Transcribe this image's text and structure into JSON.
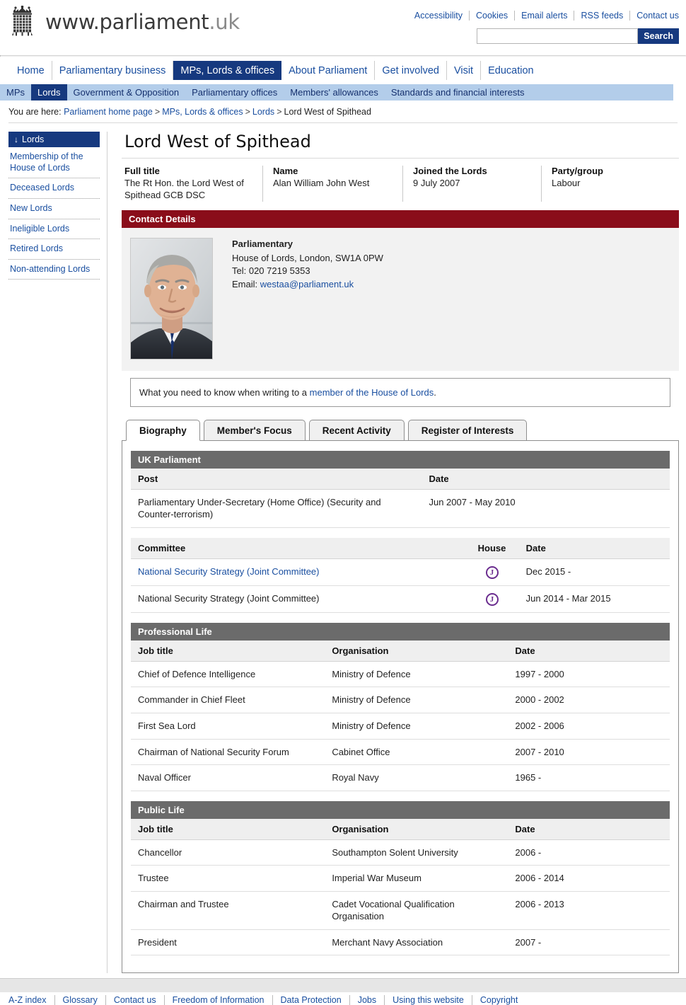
{
  "header": {
    "brand_main": "www.parliament",
    "brand_suffix": ".uk",
    "logo_icon": "portcullis-crown-icon",
    "util_links": [
      "Accessibility",
      "Cookies",
      "Email alerts",
      "RSS feeds",
      "Contact us"
    ],
    "search": {
      "value": "",
      "placeholder": "",
      "button_label": "Search"
    }
  },
  "nav_primary": {
    "items": [
      {
        "label": "Home",
        "active": false
      },
      {
        "label": "Parliamentary business",
        "active": false
      },
      {
        "label": "MPs, Lords & offices",
        "active": true
      },
      {
        "label": "About Parliament",
        "active": false
      },
      {
        "label": "Get involved",
        "active": false
      },
      {
        "label": "Visit",
        "active": false
      },
      {
        "label": "Education",
        "active": false
      }
    ]
  },
  "nav_secondary": {
    "items": [
      {
        "label": "MPs",
        "active": false
      },
      {
        "label": "Lords",
        "active": true
      },
      {
        "label": "Government & Opposition",
        "active": false
      },
      {
        "label": "Parliamentary offices",
        "active": false
      },
      {
        "label": "Members' allowances",
        "active": false
      },
      {
        "label": "Standards and financial interests",
        "active": false
      }
    ]
  },
  "breadcrumb": {
    "prefix": "You are here:",
    "items": [
      "Parliament home page",
      "MPs, Lords & offices",
      "Lords",
      "Lord West of Spithead"
    ],
    "separator": ">"
  },
  "sidebar": {
    "heading": "Lords",
    "heading_icon": "down-arrow-icon",
    "items": [
      {
        "label": "Membership of the House of Lords"
      },
      {
        "label": "Deceased Lords"
      },
      {
        "label": "New Lords"
      },
      {
        "label": "Ineligible Lords"
      },
      {
        "label": "Retired Lords"
      },
      {
        "label": "Non-attending Lords"
      }
    ]
  },
  "member": {
    "page_title": "Lord West of Spithead",
    "summary": [
      {
        "label": "Full title",
        "value": "The Rt Hon. the Lord West of Spithead GCB DSC"
      },
      {
        "label": "Name",
        "value": "Alan William John West"
      },
      {
        "label": "Joined the Lords",
        "value": "9 July 2007"
      },
      {
        "label": "Party/group",
        "value": "Labour"
      }
    ],
    "portrait_alt": "member-portrait"
  },
  "contact": {
    "section_title": "Contact Details",
    "heading": "Parliamentary",
    "address": "House of Lords, London, SW1A 0PW",
    "tel": "Tel: 020 7219 5353",
    "email_label": "Email: ",
    "email": "westaa@parliament.uk",
    "notice_prefix": "What you need to know when writing to a ",
    "notice_link": "member of the House of Lords",
    "notice_suffix": "."
  },
  "tabs": [
    {
      "label": "Biography",
      "active": true
    },
    {
      "label": "Member's Focus",
      "active": false
    },
    {
      "label": "Recent Activity",
      "active": false
    },
    {
      "label": "Register of Interests",
      "active": false
    }
  ],
  "biography": {
    "uk_parliament": {
      "section_title": "UK Parliament",
      "post_headers": [
        "Post",
        "Date"
      ],
      "posts": [
        {
          "post": "Parliamentary Under-Secretary (Home Office) (Security and Counter-terrorism)",
          "date": "Jun 2007 - May 2010"
        }
      ],
      "committee_headers": [
        "Committee",
        "House",
        "Date"
      ],
      "committees": [
        {
          "committee": "National Security Strategy (Joint Committee)",
          "house": "J",
          "house_icon": "joint-committee-badge",
          "date": "Dec 2015 -",
          "is_link": true
        },
        {
          "committee": "National Security Strategy (Joint Committee)",
          "house": "J",
          "house_icon": "joint-committee-badge",
          "date": "Jun 2014 - Mar 2015",
          "is_link": false
        }
      ]
    },
    "professional_life": {
      "section_title": "Professional Life",
      "headers": [
        "Job title",
        "Organisation",
        "Date"
      ],
      "rows": [
        {
          "job": "Chief of Defence Intelligence",
          "org": "Ministry of Defence",
          "date": "1997 - 2000"
        },
        {
          "job": "Commander in Chief Fleet",
          "org": "Ministry of Defence",
          "date": "2000 - 2002"
        },
        {
          "job": "First Sea Lord",
          "org": "Ministry of Defence",
          "date": "2002 - 2006"
        },
        {
          "job": "Chairman of National Security Forum",
          "org": "Cabinet Office",
          "date": "2007 - 2010"
        },
        {
          "job": "Naval Officer",
          "org": "Royal Navy",
          "date": "1965 -"
        }
      ]
    },
    "public_life": {
      "section_title": "Public Life",
      "headers": [
        "Job title",
        "Organisation",
        "Date"
      ],
      "rows": [
        {
          "job": "Chancellor",
          "org": "Southampton Solent University",
          "date": "2006 -"
        },
        {
          "job": "Trustee",
          "org": "Imperial War Museum",
          "date": "2006 - 2014"
        },
        {
          "job": "Chairman and Trustee",
          "org": "Cadet Vocational Qualification Organisation",
          "date": "2006 - 2013"
        },
        {
          "job": "President",
          "org": "Merchant Navy Association",
          "date": "2007 -"
        }
      ]
    }
  },
  "footer": {
    "links": [
      "A-Z index",
      "Glossary",
      "Contact us",
      "Freedom of Information",
      "Data Protection",
      "Jobs",
      "Using this website",
      "Copyright"
    ]
  },
  "colors": {
    "nav_active": "#16397f",
    "nav_secondary_bg": "#b3cdea",
    "link": "#1a4fa0",
    "section_red": "#8a0d1a",
    "section_grey": "#6b6b6b",
    "house_badge": "#6b2d8f"
  }
}
